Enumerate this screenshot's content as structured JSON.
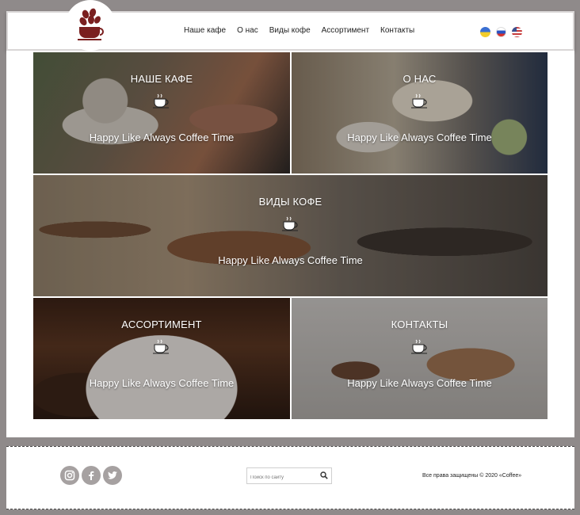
{
  "header": {
    "nav": [
      "Наше кафе",
      "О нас",
      "Виды кофе",
      "Ассортимент",
      "Контакты"
    ],
    "languages": [
      "ua",
      "ru",
      "en"
    ]
  },
  "tiles": [
    {
      "title": "НАШЕ КАФЕ",
      "tagline": "Happy Like Always Coffee Time"
    },
    {
      "title": "О НАС",
      "tagline": "Happy Like Always Coffee Time"
    },
    {
      "title": "ВИДЫ КОФЕ",
      "tagline": "Happy Like Always Coffee Time"
    },
    {
      "title": "АССОРТИМЕНТ",
      "tagline": "Happy Like Always Coffee Time"
    },
    {
      "title": "КОНТАКТЫ",
      "tagline": "Happy Like Always Coffee Time"
    }
  ],
  "footer": {
    "socials": [
      "instagram-icon",
      "facebook-icon",
      "twitter-icon"
    ],
    "search_placeholder": "Поиск по сайту",
    "copyright": "Все права защищены © 2020 «Coffee»"
  },
  "colors": {
    "background": "#8f8a8a",
    "brand": "#7a1f1f",
    "social": "#a6a1a1"
  }
}
